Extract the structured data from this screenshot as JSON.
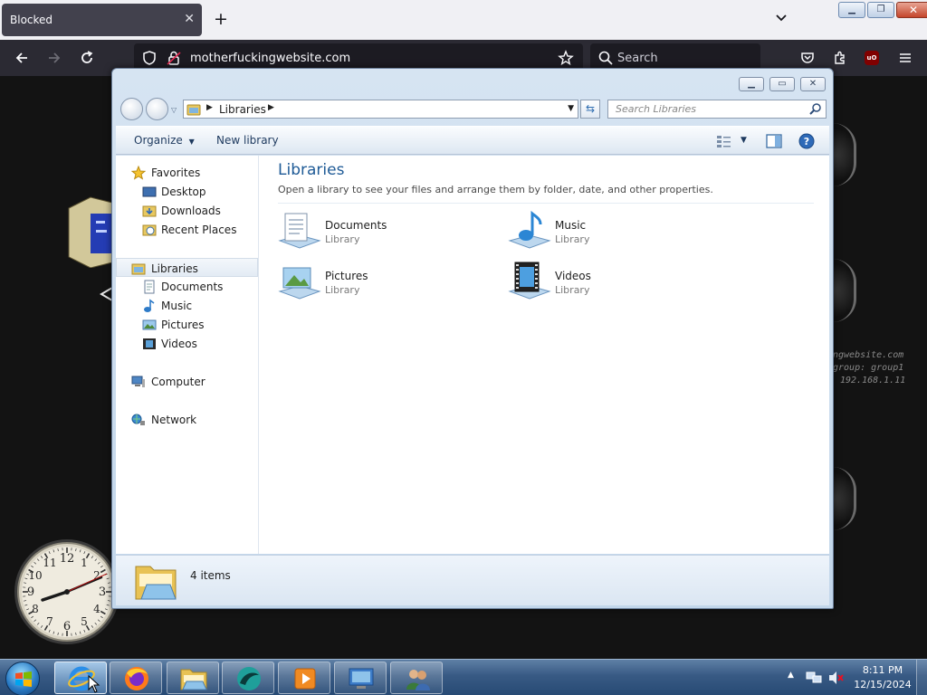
{
  "browser": {
    "tab_title": "Blocked",
    "tab_close": "✕",
    "new_tab": "+",
    "url": "motherfuckingwebsite.com",
    "search_placeholder": "Search",
    "ublock_badge": "uO"
  },
  "desktop": {
    "info_lines": [
      "ngwebsite.com",
      "group: group1",
      "192.168.1.11"
    ],
    "clock_numbers": [
      "12",
      "1",
      "2",
      "3",
      "4",
      "5",
      "6",
      "7",
      "8",
      "9",
      "10",
      "11"
    ]
  },
  "explorer": {
    "breadcrumb": "Libraries",
    "search_placeholder": "Search Libraries",
    "toolbar": {
      "organize_label": "Organize",
      "new_library_label": "New library"
    },
    "nav": {
      "favorites": "Favorites",
      "desktop": "Desktop",
      "downloads": "Downloads",
      "recent_places": "Recent Places",
      "libraries": "Libraries",
      "documents": "Documents",
      "music": "Music",
      "pictures": "Pictures",
      "videos": "Videos",
      "computer": "Computer",
      "network": "Network"
    },
    "content": {
      "heading": "Libraries",
      "description": "Open a library to see your files and arrange them by folder, date, and other properties.",
      "libraries": [
        {
          "name": "Documents",
          "type": "Library"
        },
        {
          "name": "Music",
          "type": "Library"
        },
        {
          "name": "Pictures",
          "type": "Library"
        },
        {
          "name": "Videos",
          "type": "Library"
        }
      ]
    },
    "details": {
      "item_count": "4 items"
    }
  },
  "taskbar": {
    "time": "8:11 PM",
    "date": "12/15/2024"
  },
  "colors": {
    "accent": "#1e5a96",
    "firefox_dark": "#2b2a33",
    "taskbar": "#385a84"
  }
}
